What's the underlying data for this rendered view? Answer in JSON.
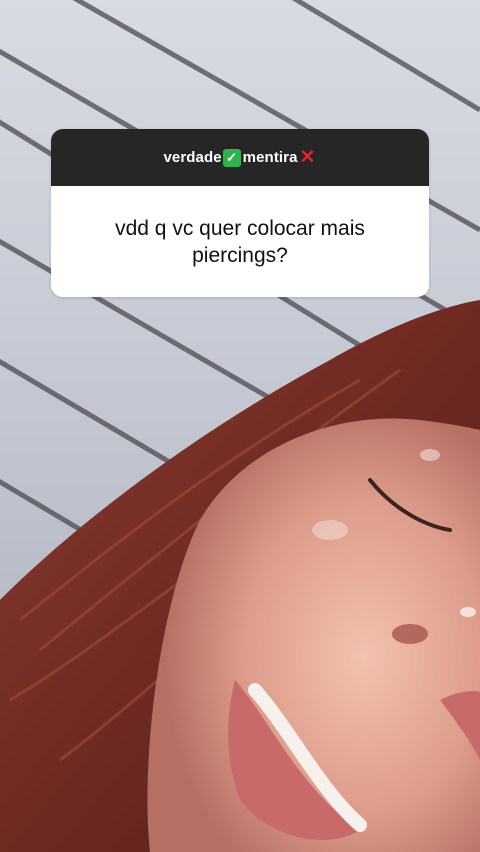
{
  "question_sticker": {
    "prompt_part1": "verdade",
    "check_icon": "check-mark-icon",
    "prompt_part2": "mentira",
    "cross_icon": "cross-mark-icon",
    "question": "vdd q vc quer colocar mais piercings?"
  },
  "colors": {
    "header_bg": "#262626",
    "card_bg": "#ffffff",
    "check_green": "#2fb34f",
    "cross_red": "#e2262e"
  }
}
